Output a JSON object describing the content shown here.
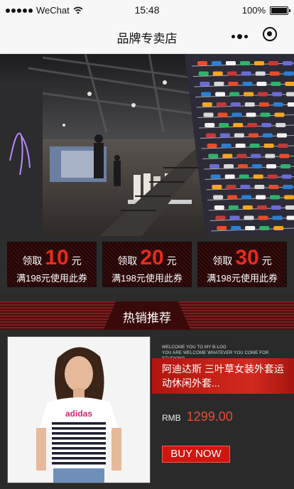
{
  "status_bar": {
    "carrier": "WeChat",
    "time": "15:48",
    "battery": "100%",
    "battery_level": 1.0
  },
  "nav": {
    "title": "品牌专卖店"
  },
  "hero": {
    "image": "store-interior-shoe-wall"
  },
  "coupons": [
    {
      "take": "领取",
      "amount": "10",
      "unit": "元",
      "condition": "满198元使用此券"
    },
    {
      "take": "领取",
      "amount": "20",
      "unit": "元",
      "condition": "满198元使用此券"
    },
    {
      "take": "领取",
      "amount": "30",
      "unit": "元",
      "condition": "满198元使用此券"
    }
  ],
  "section": {
    "title": "热销推荐"
  },
  "product": {
    "tagline_1": "WELCOME YOU TO MY B-LOG",
    "tagline_2": "YOU ARE WELCOME WHATEVER YOU COME FOR STUDYING",
    "name": "阿迪达斯 三叶草女装外套运动休闲外套...",
    "currency": "RMB",
    "price": "1299.00",
    "shirt_print": "adidas",
    "buy_label": "BUY NOW"
  },
  "colors": {
    "accent_red": "#d1150f",
    "price_red": "#e94b35",
    "coupon_amount": "#e62b1e",
    "background": "#2b2b2b"
  }
}
